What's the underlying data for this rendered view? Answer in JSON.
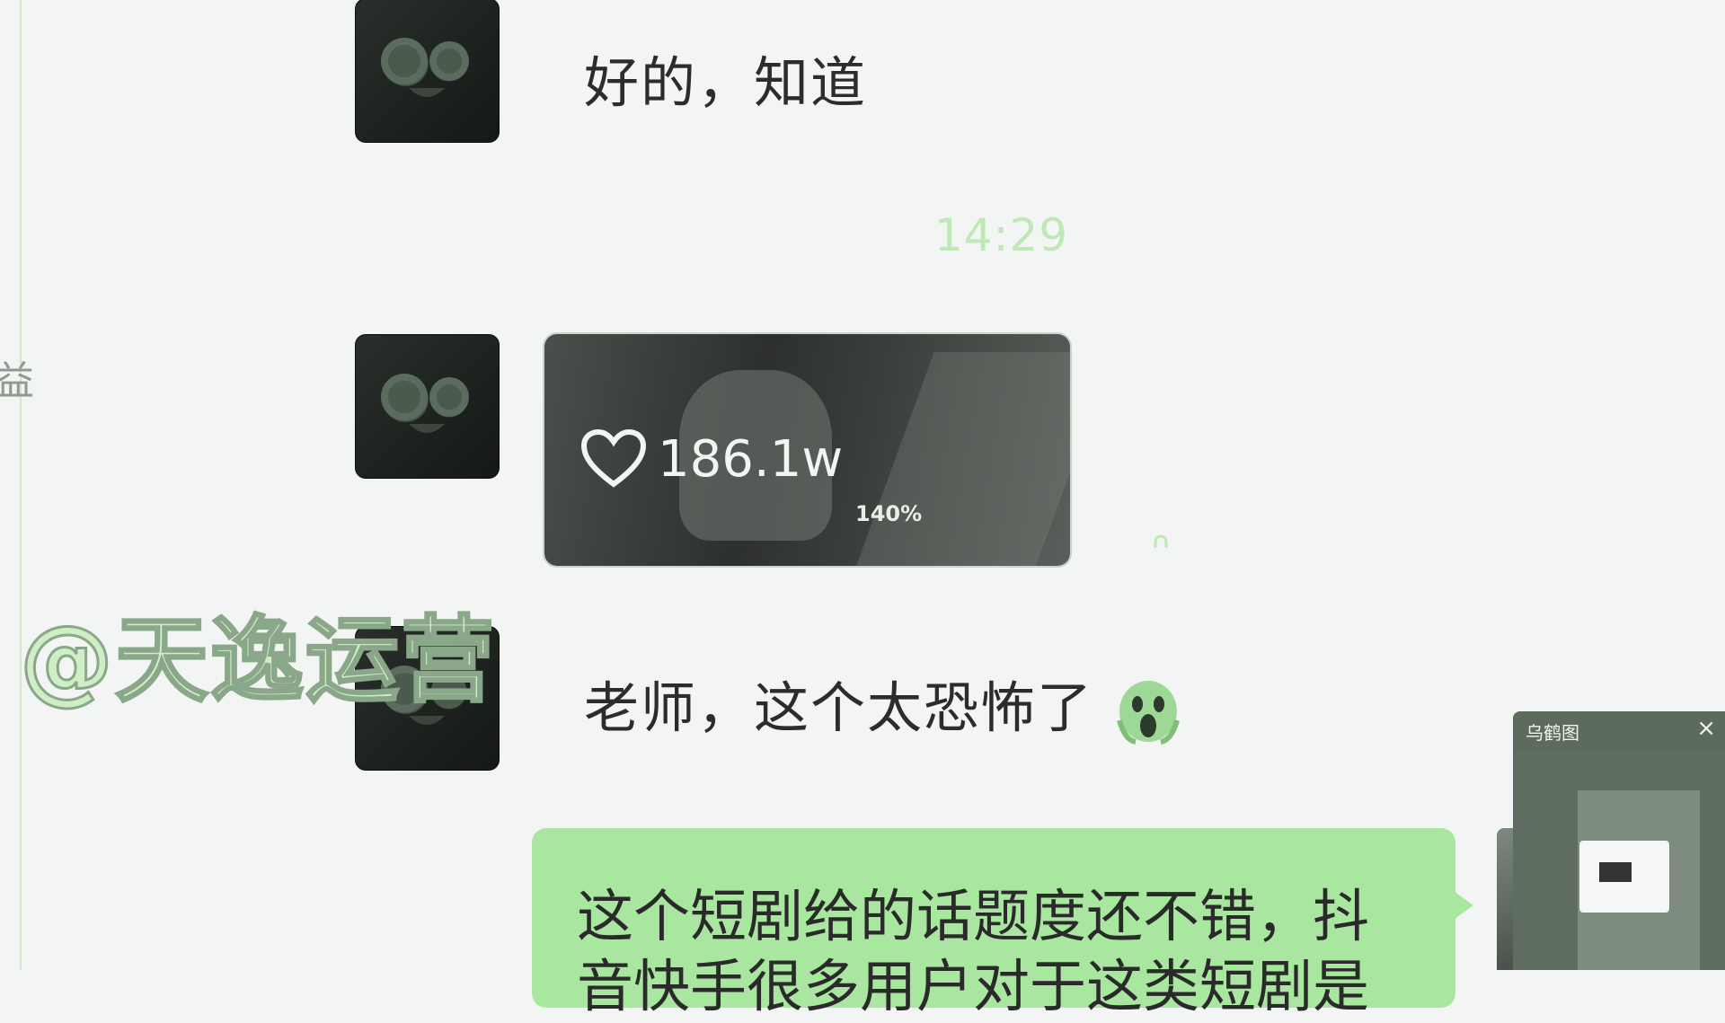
{
  "left_rail": {
    "partial_glyph": "益"
  },
  "messages": [
    {
      "type": "text",
      "text": "好的，知道"
    },
    {
      "type": "timestamp",
      "text": "14:29"
    },
    {
      "type": "video",
      "likes": "186.1w",
      "zoom": "140%"
    },
    {
      "type": "text",
      "text": "老师，这个太恐怖了",
      "emoji": "scream-emoji"
    },
    {
      "type": "outgoing",
      "line1": "这个短剧给的话题度还不错，抖",
      "line2": "音快手很多用户对于这类短剧是"
    }
  ],
  "watermark": {
    "text": "@天逸运营"
  },
  "mini_panel": {
    "title": "乌鹤图",
    "close": "×"
  },
  "colors": {
    "bubble_green": "#a9e7a0",
    "timestamp": "#bfe8b6",
    "watermark": "#cfeec6"
  }
}
